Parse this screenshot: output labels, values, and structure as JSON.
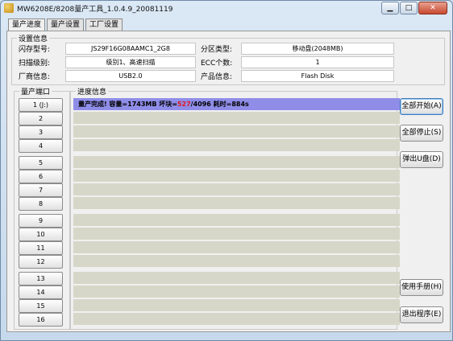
{
  "window": {
    "title": "MW6208E/8208量产工具_1.0.4.9_20081119",
    "minimize": "▁",
    "maximize": "□",
    "close": "✕"
  },
  "tabs": [
    "量产进度",
    "量产设置",
    "工厂设置"
  ],
  "settings": {
    "group_label": "设置信息",
    "flash_model_label": "闪存型号:",
    "flash_model": "JS29F16G08AAMC1_2G8",
    "partition_label": "分区类型:",
    "partition": "移动盘(2048MB)",
    "scan_level_label": "扫描级别:",
    "scan_level": "级别1、高速扫描",
    "ecc_label": "ECC个数:",
    "ecc": "1",
    "vendor_label": "厂商信息:",
    "vendor": "USB2.0",
    "product_label": "产品信息:",
    "product": "Flash Disk"
  },
  "ports_group_label": "量产端口",
  "progress_group_label": "进度信息",
  "ports": [
    "1 (J:)",
    "2",
    "3",
    "4",
    "5",
    "6",
    "7",
    "8",
    "9",
    "10",
    "11",
    "12",
    "13",
    "14",
    "15",
    "16"
  ],
  "progress": {
    "prefix": "量产完成! 容量=1743MB 坏块=",
    "bad_blocks": "527",
    "suffix": "/4096  耗时=884s"
  },
  "buttons": {
    "start_all": "全部开始(A)",
    "stop_all": "全部停止(S)",
    "eject": "弹出U盘(D)",
    "manual": "使用手册(H)",
    "exit": "退出程序(E)"
  }
}
